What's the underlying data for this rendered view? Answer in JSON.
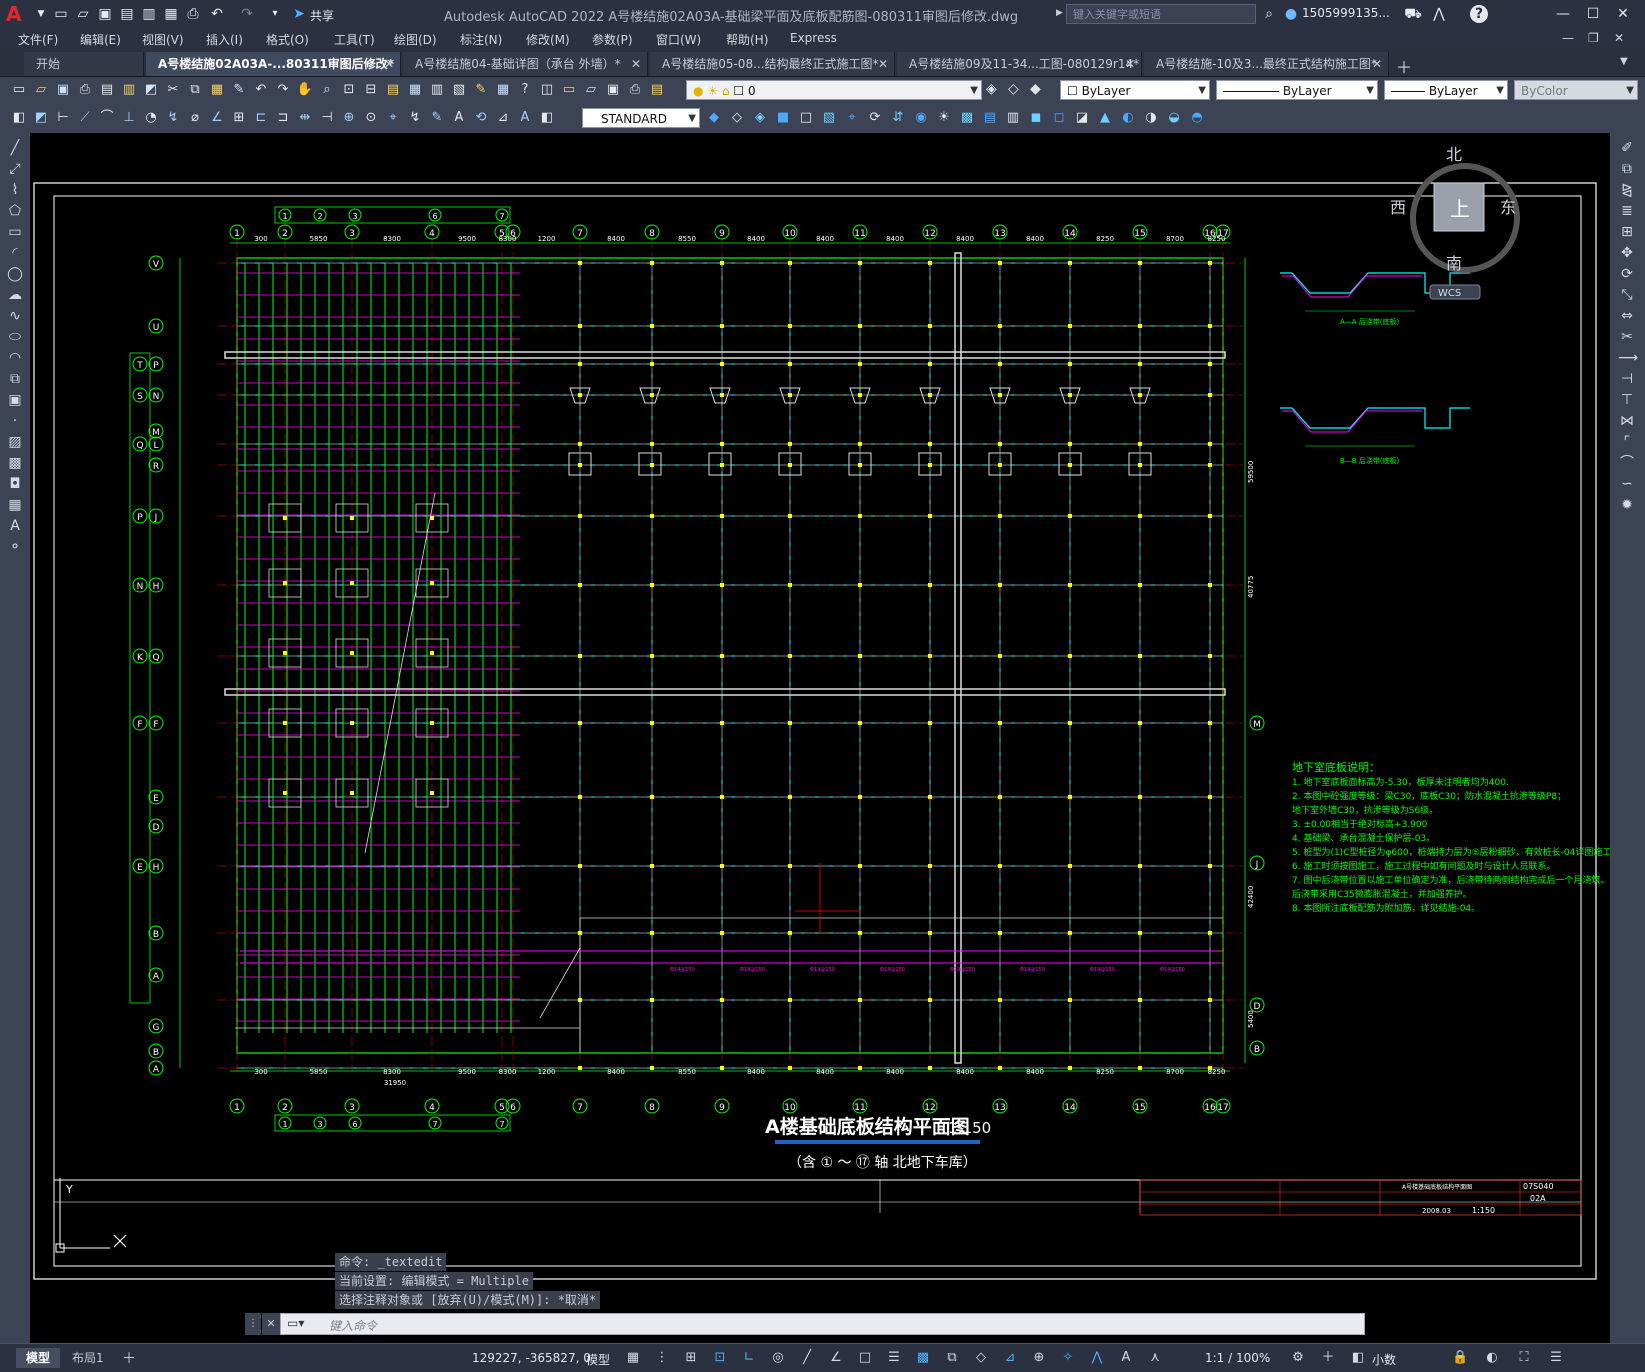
{
  "app": {
    "logo": "A",
    "title": "Autodesk AutoCAD 2022    A号楼结施02A03A-基础梁平面及底板配筋图-080311审图后修改.dwg",
    "share_label": "共享",
    "search_placeholder": "键入关键字或短语",
    "user": "1505999135...",
    "help": "?"
  },
  "menu": [
    "文件(F)",
    "编辑(E)",
    "视图(V)",
    "插入(I)",
    "格式(O)",
    "工具(T)",
    "绘图(D)",
    "标注(N)",
    "修改(M)",
    "参数(P)",
    "窗口(W)",
    "帮助(H)",
    "Express"
  ],
  "tabs": [
    {
      "label": "开始",
      "active": false
    },
    {
      "label": "A号楼结施02A03A-...80311审图后修改*",
      "active": true
    },
    {
      "label": "A号楼结施04-基础详图（承台 外墙）*",
      "active": false
    },
    {
      "label": "A号楼结施05-08...结构最终正式施工图*",
      "active": false
    },
    {
      "label": "A号楼结施09及11-34...工图-080129r14*",
      "active": false
    },
    {
      "label": "A号楼结施-10及3...最终正式结构施工图*",
      "active": false
    }
  ],
  "toolbar": {
    "layer": "0",
    "color": "ByLayer",
    "linetype": "ByLayer",
    "lineweight": "ByLayer",
    "plotstyle": "ByColor",
    "textstyle": "STANDARD"
  },
  "viewcube": {
    "north": "北",
    "south": "南",
    "east": "东",
    "west": "西",
    "top": "上",
    "wcs": "WCS"
  },
  "drawing": {
    "title": "A楼基础底板结构平面图",
    "scale": "1:150",
    "subtitle": "（含 ① ～ ⑰ 轴 北地下车库）",
    "top_axes": [
      "1",
      "2",
      "3",
      "4",
      "5",
      "6",
      "7",
      "8",
      "9",
      "10",
      "11",
      "12",
      "13",
      "14",
      "15",
      "16",
      "17"
    ],
    "top_dims": [
      "300",
      "5850",
      "8300",
      "9500",
      "8300",
      "1200",
      "8400",
      "8550",
      "8400",
      "8400",
      "8400",
      "8400",
      "8400",
      "8250",
      "8700",
      "8250",
      "1500"
    ],
    "bottom_total": "31950",
    "left_axes": [
      "V",
      "U",
      "P",
      "N",
      "M",
      "L",
      "R",
      "J",
      "H",
      "Q",
      "F",
      "E",
      "D",
      "H",
      "B",
      "A",
      "G",
      "B",
      "A"
    ],
    "left_axes2": [
      "T",
      "S",
      "Q",
      "P",
      "N",
      "K",
      "F",
      "E"
    ],
    "right_axes": [
      "M",
      "J",
      "D",
      "B"
    ],
    "right_dims": [
      "59500",
      "40775",
      "42400",
      "5400"
    ],
    "notes_title": "地下室底板说明：",
    "notes": [
      "1. 地下室底板面标高为-5.30，板厚未注明者均为400.",
      "2. 本图中砼强度等级：梁C30，底板C30；防水混凝土抗渗等级P8；",
      "   地下室外墙C30，抗渗等级为S6级。",
      "3. ±0.00相当于绝对标高+3.900",
      "4. 基础梁、承台混凝土保护层-03。",
      "5. 桩型为(1)C型桩径为φ600，桩端持力层为⑤层粉细砂，有效桩长-04详图施工",
      "6. 施工时须按图施工，施工过程中如有问题及时与设计人员联系。",
      "7. 图中后浇带位置以施工单位确定为准，后浇带待两侧结构完成后一个月浇筑。",
      "   后浇带采用C35微膨胀混凝土，并加强养护。",
      "8. 本图所注底板配筋为附加筋，详见结施-04。"
    ],
    "section_a": "A—A 后浇带(底板)",
    "section_b": "B—B 后浇带(底板)",
    "sheet_no": "07S040",
    "sheet_code": "02A",
    "sheet_scale": "1:150",
    "sheet_date": "2008.03",
    "sheet_title": "A号楼基础底板结构平面图"
  },
  "command": {
    "history": [
      "命令: _textedit",
      "当前设置: 编辑模式 = Multiple",
      "选择注释对象或 [放弃(U)/模式(M)]: *取消*"
    ],
    "placeholder": "键入命令"
  },
  "status": {
    "layouts": [
      {
        "label": "模型",
        "active": true
      },
      {
        "label": "布局1",
        "active": false
      }
    ],
    "coords": "129227, -365827, 0",
    "space": "模型",
    "annoscale": "1:1 / 100%",
    "units": "小数"
  },
  "colors": {
    "canvas": "#000000",
    "axis_green": "#00ff00",
    "grid_cyan": "#00ffff",
    "rebar_magenta": "#ff00ff",
    "column_yellow": "#ffff00",
    "gridline_red": "#ff0000",
    "ui_bg": "#2b3140"
  }
}
